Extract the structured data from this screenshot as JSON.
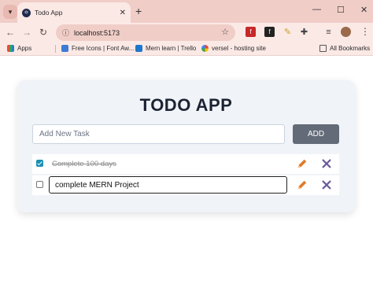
{
  "browser": {
    "tab_title": "Todo App",
    "tab_close": "✕",
    "new_tab": "+",
    "url": "localhost:5173",
    "window_controls": {
      "minimize": "—",
      "maximize": "☐",
      "close": "✕"
    },
    "bookmarks": [
      {
        "label": "Apps"
      },
      {
        "label": "Free Icons | Font Aw..."
      },
      {
        "label": "Mern learn | Trello"
      },
      {
        "label": "versel - hosting site"
      },
      {
        "label": "All Bookmarks"
      }
    ]
  },
  "app": {
    "title": "TODO APP",
    "input_placeholder": "Add New Task",
    "add_label": "ADD",
    "todos": [
      {
        "text": "Complete 100 days",
        "completed": true,
        "editing": false
      },
      {
        "text": "complete MERN Project",
        "completed": false,
        "editing": true
      }
    ]
  },
  "colors": {
    "tab_strip": "#f0cdc7",
    "toolbar": "#fbe9e6",
    "card_bg": "#f0f3f8",
    "add_button": "#646b78",
    "edit_icon": "#e07b2a",
    "delete_icon": "#6a5a9a",
    "checkbox_checked": "#1a8fb5"
  }
}
